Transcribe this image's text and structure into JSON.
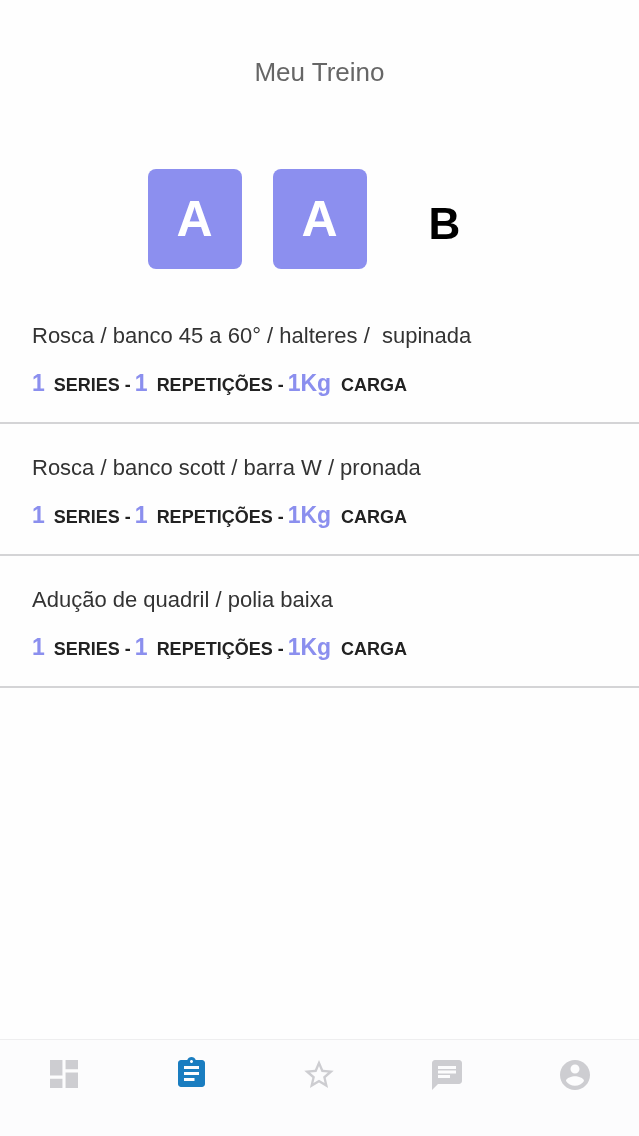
{
  "header": {
    "title": "Meu Treino"
  },
  "workouts": [
    {
      "label": "A",
      "selected": true
    },
    {
      "label": "A",
      "selected": true
    },
    {
      "label": "B",
      "selected": false
    }
  ],
  "exercises": [
    {
      "name": "Rosca / banco 45 a 60° / halteres /  supinada",
      "series": "1",
      "series_label": "SERIES -",
      "reps": "1",
      "reps_label": "REPETIÇÕES -",
      "load": "1Kg",
      "load_label": "CARGA"
    },
    {
      "name": "Rosca / banco scott / barra W / pronada",
      "series": "1",
      "series_label": "SERIES -",
      "reps": "1",
      "reps_label": "REPETIÇÕES -",
      "load": "1Kg",
      "load_label": "CARGA"
    },
    {
      "name": "Adução de quadril / polia baixa",
      "series": "1",
      "series_label": "SERIES -",
      "reps": "1",
      "reps_label": "REPETIÇÕES -",
      "load": "1Kg",
      "load_label": "CARGA"
    }
  ],
  "tab_bar": {
    "items": [
      {
        "selected": false
      },
      {
        "selected": true
      },
      {
        "selected": false
      },
      {
        "selected": false
      },
      {
        "selected": false
      }
    ]
  }
}
